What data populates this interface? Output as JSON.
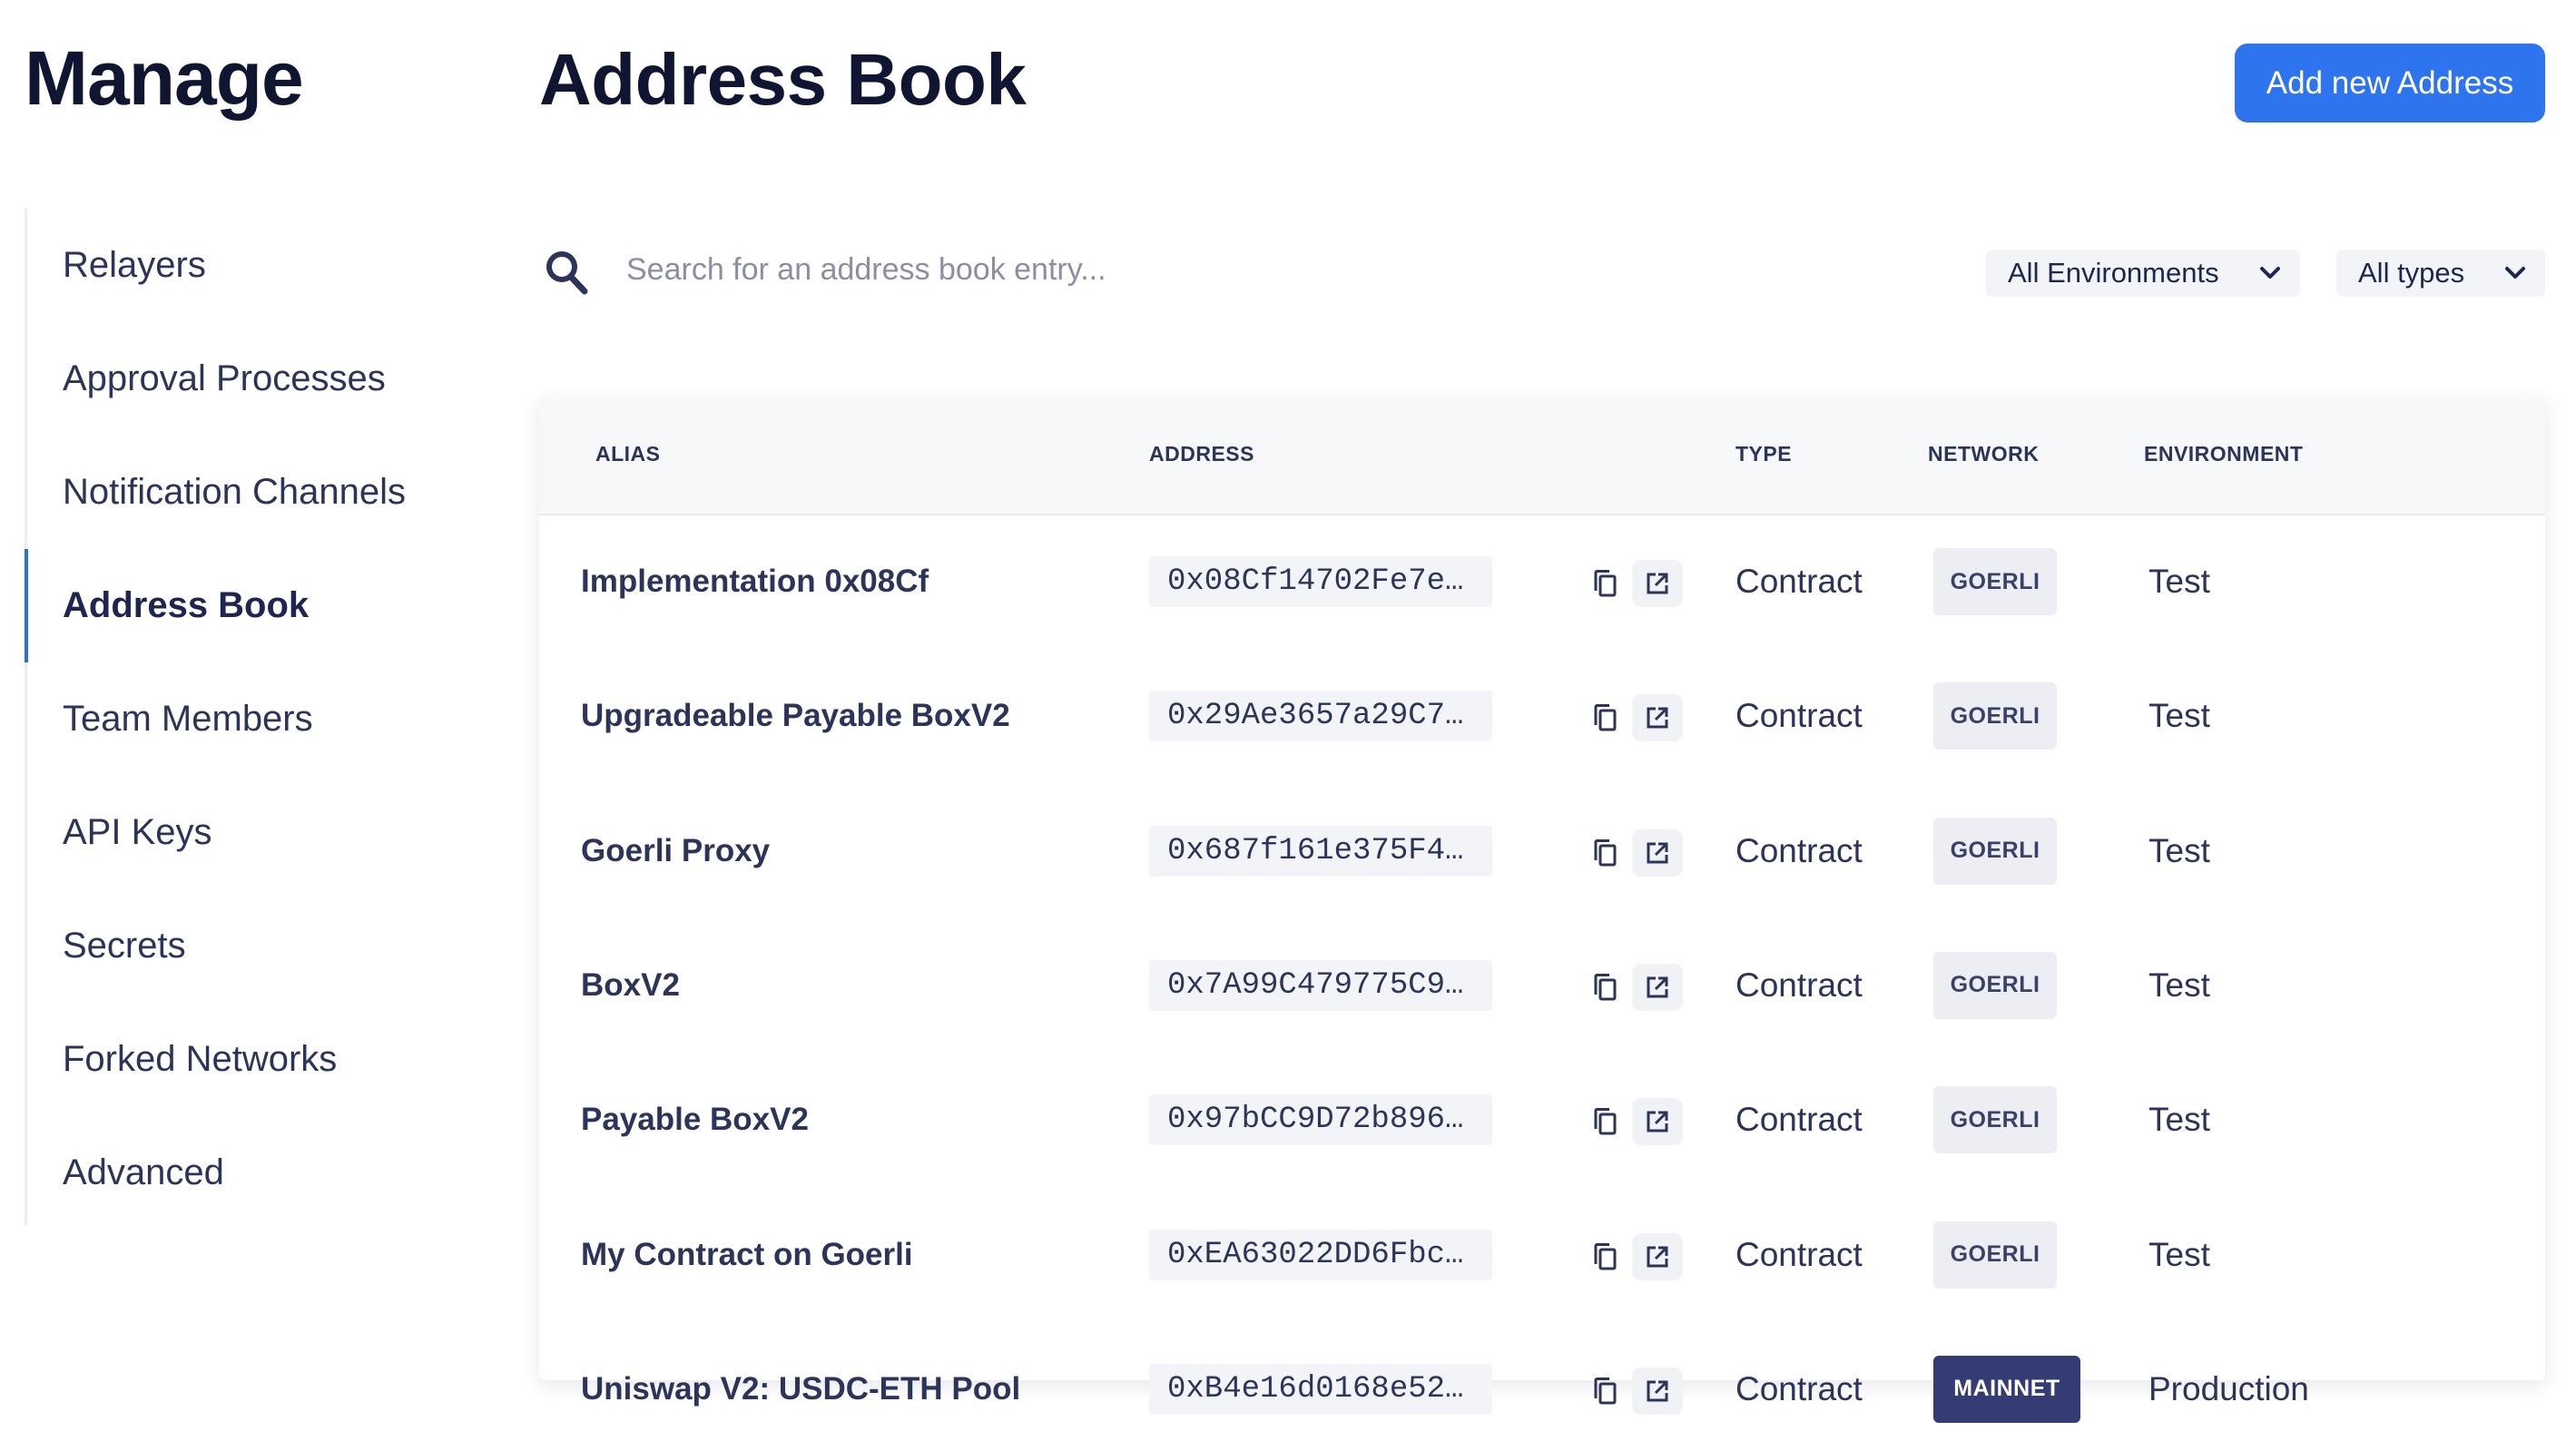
{
  "sidebar": {
    "title": "Manage",
    "items": [
      {
        "label": "Relayers"
      },
      {
        "label": "Approval Processes"
      },
      {
        "label": "Notification Channels"
      },
      {
        "label": "Address Book"
      },
      {
        "label": "Team Members"
      },
      {
        "label": "API Keys"
      },
      {
        "label": "Secrets"
      },
      {
        "label": "Forked Networks"
      },
      {
        "label": "Advanced"
      }
    ],
    "active_item": "Address Book"
  },
  "header": {
    "title": "Address Book",
    "add_button_label": "Add new Address"
  },
  "search": {
    "placeholder": "Search for an address book entry...",
    "value": ""
  },
  "filters": {
    "environment_selected": "All Environments",
    "type_selected": "All types"
  },
  "table": {
    "columns": [
      "ALIAS",
      "ADDRESS",
      "TYPE",
      "NETWORK",
      "ENVIRONMENT"
    ],
    "rows": [
      {
        "alias": "Implementation 0x08Cf",
        "address": "0x08Cf14702Fe7e…",
        "type": "Contract",
        "network": "GOERLI",
        "environment": "Test"
      },
      {
        "alias": "Upgradeable Payable BoxV2",
        "address": "0x29Ae3657a29C7…",
        "type": "Contract",
        "network": "GOERLI",
        "environment": "Test"
      },
      {
        "alias": "Goerli Proxy",
        "address": "0x687f161e375F4…",
        "type": "Contract",
        "network": "GOERLI",
        "environment": "Test"
      },
      {
        "alias": "BoxV2",
        "address": "0x7A99C479775C9…",
        "type": "Contract",
        "network": "GOERLI",
        "environment": "Test"
      },
      {
        "alias": "Payable BoxV2",
        "address": "0x97bCC9D72b896…",
        "type": "Contract",
        "network": "GOERLI",
        "environment": "Test"
      },
      {
        "alias": "My Contract on Goerli",
        "address": "0xEA63022DD6Fbc…",
        "type": "Contract",
        "network": "GOERLI",
        "environment": "Test"
      },
      {
        "alias": "Uniswap V2: USDC-ETH Pool",
        "address": "0xB4e16d0168e52…",
        "type": "Contract",
        "network": "MAINNET",
        "environment": "Production"
      }
    ]
  },
  "icons": {
    "search": "search-icon",
    "dropdown": "chevron-down-icon",
    "copy": "copy-icon",
    "external": "external-link-icon"
  },
  "colors": {
    "accent": "#2e74ef",
    "active_nav_bar": "#2f6ddf",
    "mainnet_badge": "#353c74",
    "goerli_badge": "#eceef4"
  }
}
